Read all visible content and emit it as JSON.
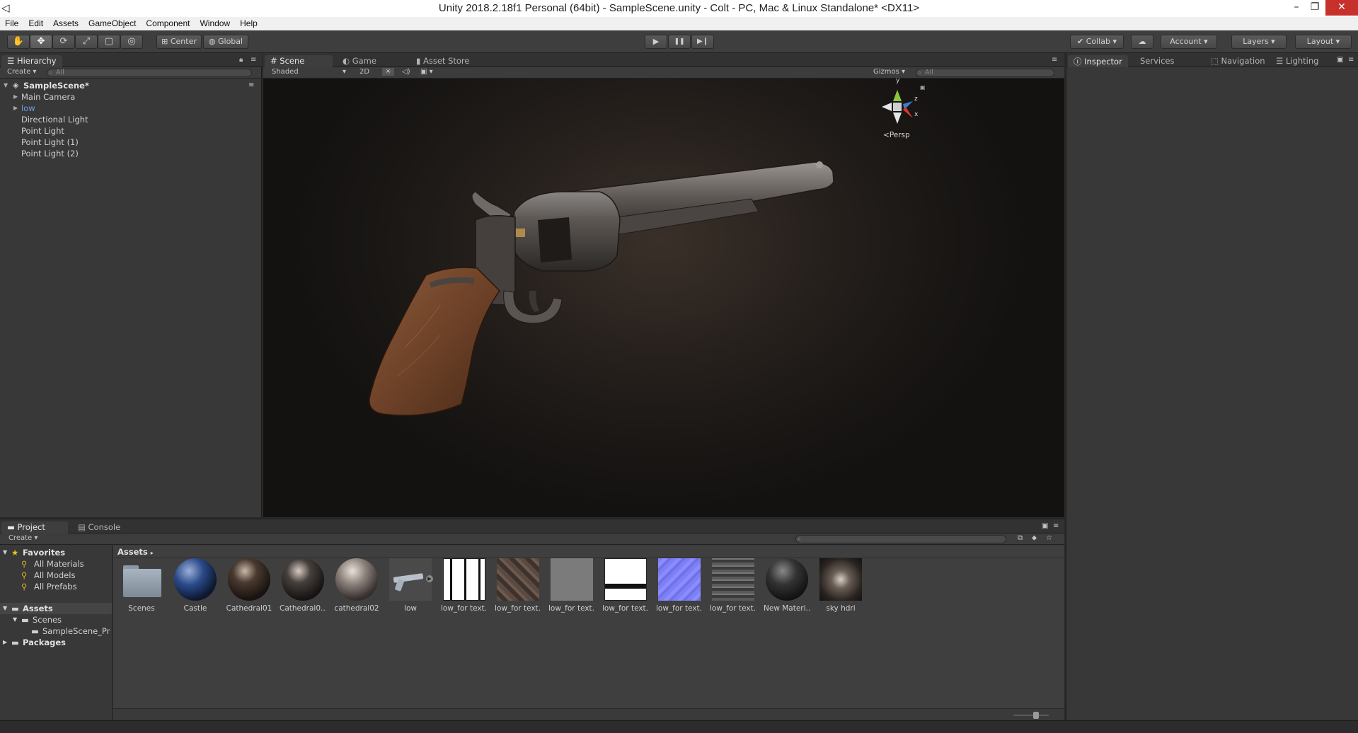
{
  "window": {
    "title": "Unity 2018.2.18f1 Personal (64bit) - SampleScene.unity - Colt - PC, Mac & Linux Standalone* <DX11>",
    "minimize": "–",
    "restore": "❐",
    "close": "✕"
  },
  "menu": [
    "File",
    "Edit",
    "Assets",
    "GameObject",
    "Component",
    "Window",
    "Help"
  ],
  "toolbar": {
    "tools": [
      "✋",
      "✥",
      "⟳",
      "⤢",
      "▢",
      "◎"
    ],
    "pivot": "Center",
    "space": "Global",
    "play": "▶",
    "pause": "❚❚",
    "step": "▶❙",
    "collab": "Collab",
    "cloud": "☁",
    "account": "Account",
    "layers": "Layers",
    "layout": "Layout"
  },
  "hierarchy": {
    "tab": "Hierarchy",
    "create": "Create",
    "search_placeholder": "All",
    "scene": "SampleScene*",
    "items": [
      {
        "label": "Main Camera",
        "expandable": true
      },
      {
        "label": "low",
        "expandable": true,
        "prefab": true
      },
      {
        "label": "Directional Light",
        "expandable": false
      },
      {
        "label": "Point Light",
        "expandable": false
      },
      {
        "label": "Point Light (1)",
        "expandable": false
      },
      {
        "label": "Point Light (2)",
        "expandable": false
      }
    ]
  },
  "scene_view": {
    "tabs": [
      "Scene",
      "Game",
      "Asset Store"
    ],
    "shading": "Shaded",
    "mode2d": "2D",
    "gizmos": "Gizmos",
    "search_placeholder": "All",
    "projection": "Persp",
    "axis_labels": {
      "y": "y",
      "z": "z",
      "x": "x"
    }
  },
  "inspector": {
    "tabs": [
      "Inspector",
      "Services",
      "Navigation",
      "Lighting"
    ]
  },
  "project": {
    "tabs": [
      "Project",
      "Console"
    ],
    "create": "Create",
    "breadcrumb": "Assets",
    "tree": {
      "favorites": "Favorites",
      "favorite_items": [
        "All Materials",
        "All Models",
        "All Prefabs"
      ],
      "assets": "Assets",
      "scenes": "Scenes",
      "scene_file": "SampleScene_Pr",
      "packages": "Packages"
    },
    "assets": [
      {
        "label": "Scenes",
        "kind": "folder"
      },
      {
        "label": "Castle",
        "kind": "sphere",
        "color": "#1e3a6e"
      },
      {
        "label": "Cathedral01",
        "kind": "sphere",
        "color": "#3a2a22"
      },
      {
        "label": "Cathedral0...",
        "kind": "sphere",
        "color": "#2e2724"
      },
      {
        "label": "cathedral02",
        "kind": "sphere",
        "color": "#5a4e48"
      },
      {
        "label": "low",
        "kind": "model"
      },
      {
        "label": "low_for text...",
        "kind": "tex-white"
      },
      {
        "label": "low_for text...",
        "kind": "tex-brown"
      },
      {
        "label": "low_for text...",
        "kind": "tex-gray"
      },
      {
        "label": "low_for text...",
        "kind": "tex-white2"
      },
      {
        "label": "low_for text...",
        "kind": "tex-normal"
      },
      {
        "label": "low_for text...",
        "kind": "tex-dark"
      },
      {
        "label": "New Materi...",
        "kind": "sphere",
        "color": "#222222"
      },
      {
        "label": "sky hdri",
        "kind": "hdri"
      }
    ]
  }
}
